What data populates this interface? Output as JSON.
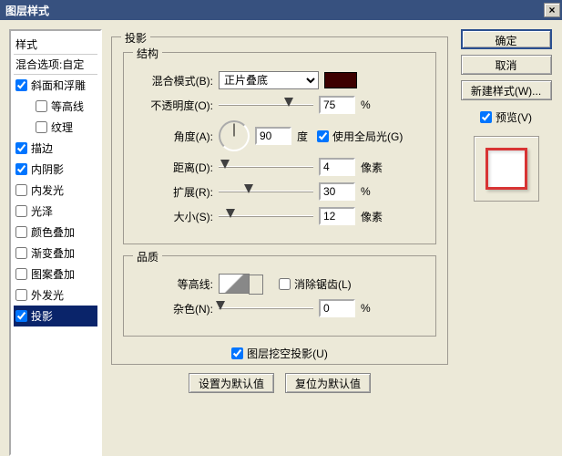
{
  "window": {
    "title": "图层样式"
  },
  "sidebar": {
    "header": "样式",
    "blendHeader": "混合选项:自定",
    "items": [
      {
        "label": "斜面和浮雕",
        "checked": true,
        "sub": false
      },
      {
        "label": "等高线",
        "checked": false,
        "sub": true
      },
      {
        "label": "纹理",
        "checked": false,
        "sub": true
      },
      {
        "label": "描边",
        "checked": true,
        "sub": false
      },
      {
        "label": "内阴影",
        "checked": true,
        "sub": false
      },
      {
        "label": "内发光",
        "checked": false,
        "sub": false
      },
      {
        "label": "光泽",
        "checked": false,
        "sub": false
      },
      {
        "label": "颜色叠加",
        "checked": false,
        "sub": false
      },
      {
        "label": "渐变叠加",
        "checked": false,
        "sub": false
      },
      {
        "label": "图案叠加",
        "checked": false,
        "sub": false
      },
      {
        "label": "外发光",
        "checked": false,
        "sub": false
      },
      {
        "label": "投影",
        "checked": true,
        "sub": false,
        "selected": true
      }
    ]
  },
  "panel": {
    "title": "投影",
    "struct": "结构",
    "blendMode": {
      "label": "混合模式(B):",
      "value": "正片叠底"
    },
    "color": "#3d0000",
    "opacity": {
      "label": "不透明度(O):",
      "value": "75",
      "unit": "%"
    },
    "angle": {
      "label": "角度(A):",
      "value": "90",
      "unit": "度"
    },
    "globalLight": {
      "label": "使用全局光(G)",
      "checked": true
    },
    "distance": {
      "label": "距离(D):",
      "value": "4",
      "unit": "像素"
    },
    "spread": {
      "label": "扩展(R):",
      "value": "30",
      "unit": "%"
    },
    "size": {
      "label": "大小(S):",
      "value": "12",
      "unit": "像素"
    },
    "quality": "品质",
    "contour": {
      "label": "等高线:"
    },
    "antialias": {
      "label": "消除锯齿(L)",
      "checked": false
    },
    "noise": {
      "label": "杂色(N):",
      "value": "0",
      "unit": "%"
    },
    "knockout": {
      "label": "图层挖空投影(U)",
      "checked": true
    },
    "btnDefault": "设置为默认值",
    "btnReset": "复位为默认值"
  },
  "right": {
    "ok": "确定",
    "cancel": "取消",
    "newStyle": "新建样式(W)...",
    "preview": {
      "label": "预览(V)",
      "checked": true
    }
  }
}
